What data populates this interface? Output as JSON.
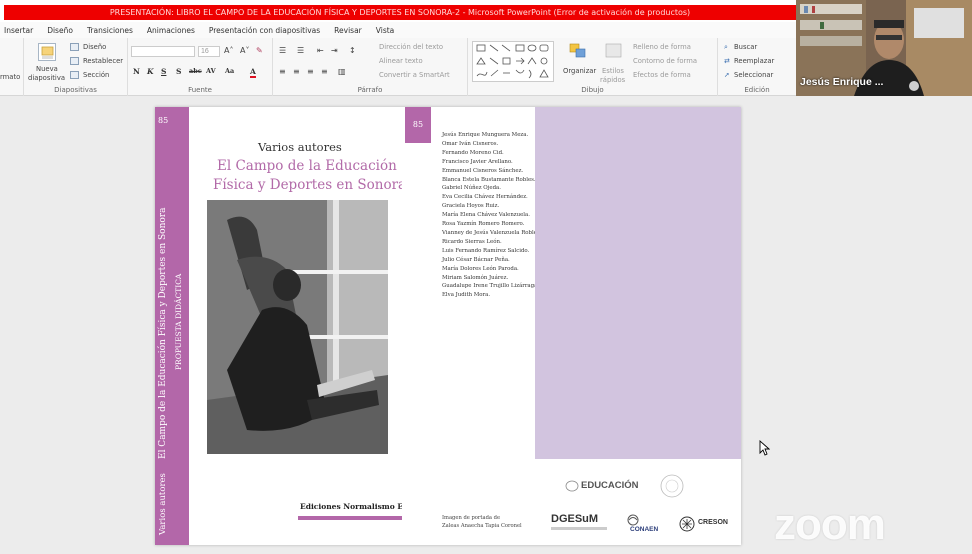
{
  "window": {
    "title": "PRESENTACIÓN: LIBRO EL CAMPO DE LA EDUCACIÓN FÍSICA Y DEPORTES EN SONORA-2  -  Microsoft PowerPoint (Error de activación de productos)"
  },
  "menu": {
    "tabs": [
      "Insertar",
      "Diseño",
      "Transiciones",
      "Animaciones",
      "Presentación con diapositivas",
      "Revisar",
      "Vista"
    ]
  },
  "ribbon": {
    "left_cut": "rmato",
    "diapositivas": {
      "new_slide_line1": "Nueva",
      "new_slide_line2": "diapositiva",
      "layout": "Diseño",
      "reset": "Restablecer",
      "section": "Sección",
      "label": "Diapositivas"
    },
    "fuente": {
      "label": "Fuente",
      "font_size": "16"
    },
    "parrafo": {
      "text_direction": "Dirección del texto",
      "align_text": "Alinear texto",
      "smartart": "Convertir a SmartArt",
      "label": "Párrafo"
    },
    "dibujo": {
      "arrange": "Organizar",
      "quick_styles_line1": "Estilos",
      "quick_styles_line2": "rápidos",
      "shape_fill": "Relleno de forma",
      "shape_outline": "Contorno de forma",
      "shape_effects": "Efectos de forma",
      "label": "Dibujo"
    },
    "edicion": {
      "find": "Buscar",
      "replace": "Reemplazar",
      "select": "Seleccionar",
      "label": "Edición"
    }
  },
  "slide": {
    "spine_number": "85",
    "spine_title": "El Campo de la Educación Física y Deportes en Sonora",
    "spine_subtitle": "PROPUESTA DIDÁCTICA",
    "spine_authors": "Varios autores",
    "front_authors": "Varios autores",
    "front_title_line1": "El Campo de la Educación",
    "front_title_line2": "Física y Deportes en Sonora",
    "publisher": "Ediciones Normalismo Extraordinario",
    "back_number": "85",
    "authors_list": [
      "Jesús Enrique Munguera Meza.",
      "Omar Iván Cisneros.",
      "Fernando Moreno Cid.",
      "Francisco Javier Arellano.",
      "Emmanuel Cisneros Sánchez.",
      "Blanca Estela Bustamante Robles.",
      "Gabriel Núñez Ojeda.",
      "Eva Cecilia Chávez Hernández.",
      "Graciela Hoyos Ruiz.",
      "María Elena Chávez Valenzuela.",
      "Rosa Yazmín Romero Romero.",
      "Vianney de Jesús Valenzuela Robles.",
      "Ricardo Sierras León.",
      "Luis Fernando Ramírez Salcido.",
      "Julio César Bácnar Peña.",
      "María Dolores León Paroda.",
      "Miriam Salomón Juárez.",
      "Guadalupe Irene Trujillo Lizárraga.",
      "Elva Judith Mora."
    ],
    "credit_line1": "Imagen de portada de",
    "credit_line2": "Zaleas Anaecha Tapia Coronel",
    "logos": {
      "sep": "EDUCACIÓN",
      "dgesum": "DGESuM",
      "conaen": "CONAEN",
      "creson": "CRESON"
    }
  },
  "video": {
    "participant_name": "Jesús Enrique ..."
  },
  "app_logo": "zoom",
  "colors": {
    "title_bar_red": "#ee0000",
    "book_purple": "#b367a9",
    "book_lilac": "#d2c4df"
  }
}
